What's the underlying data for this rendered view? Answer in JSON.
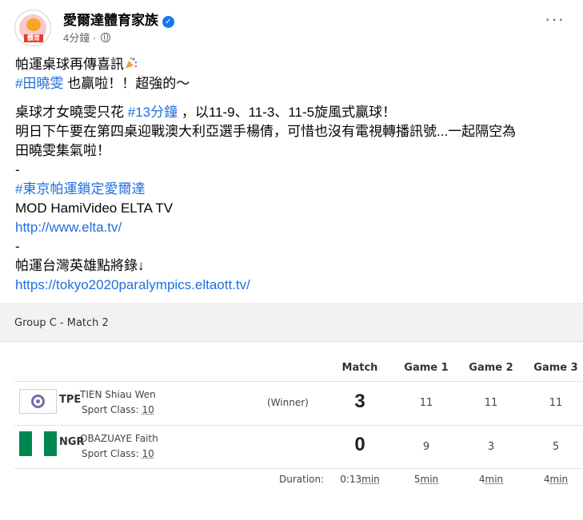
{
  "post": {
    "page_name": "愛爾達體育家族",
    "avatar_badge": "體育",
    "timestamp": "4分鐘",
    "separator": "·",
    "paragraph1": {
      "line1": "帕運桌球再傳喜訊",
      "hashtag1": "#田曉雯",
      "line2_rest": " 也贏啦！！超強的～"
    },
    "paragraph2": {
      "line1_a": "桌球才女曉雯只花 ",
      "hashtag2": "#13分鐘",
      "line1_b": " ，以11-9、11-3、11-5旋風式贏球！",
      "line2": "明日下午要在第四桌迎戰澳大利亞選手楊倩，可惜也沒有電視轉播訊號...一起隔空為",
      "line3": "田曉雯集氣啦！",
      "dash1": "-",
      "hashtag3": "#東京帕運鎖定愛爾達",
      "line5": "MOD HamiVideo ELTA TV",
      "link1": "http://www.elta.tv/",
      "dash2": "-",
      "line8": "帕運台灣英雄點將錄↓",
      "link2": "https://tokyo2020paralympics.eltaott.tv/"
    }
  },
  "match_card": {
    "group_title": "Group C  - Match 2",
    "headers": {
      "match": "Match",
      "game1": "Game 1",
      "game2": "Game 2",
      "game3": "Game 3"
    },
    "players": [
      {
        "code": "TPE",
        "name": "TIEN Shiau Wen",
        "class_label": "Sport Class: ",
        "class_value": "10",
        "result": "(Winner)",
        "match_score": "3",
        "games": [
          "11",
          "11",
          "11"
        ]
      },
      {
        "code": "NGR",
        "name": "OBAZUAYE Faith",
        "class_label": "Sport Class: ",
        "class_value": "10",
        "result": "",
        "match_score": "0",
        "games": [
          "9",
          "3",
          "5"
        ]
      }
    ],
    "duration": {
      "label": "Duration:",
      "match_num": "0:13",
      "match_unit": "min",
      "game1_num": "5",
      "game1_unit": "min",
      "game2_num": "4",
      "game2_unit": "min",
      "game3_num": "4",
      "game3_unit": "min"
    }
  },
  "colors": {
    "link": "#216fdb",
    "verified": "#1877f2",
    "nigeria_green": "#008751"
  }
}
